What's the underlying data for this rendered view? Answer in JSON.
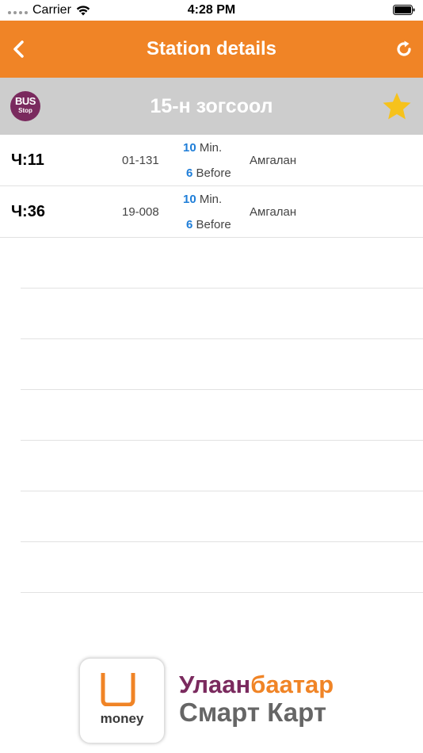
{
  "status_bar": {
    "carrier": "Carrier",
    "time": "4:28 PM"
  },
  "nav": {
    "title": "Station details",
    "back_icon": "chevron-left-icon",
    "refresh_icon": "refresh-icon"
  },
  "station": {
    "logo_line1": "BUS",
    "logo_line2": "Stop",
    "name": "15-н зогсоол",
    "favorite": true
  },
  "schedule": [
    {
      "time": "Ч:11",
      "number": "01-131",
      "mins_value": "10",
      "mins_label": " Min.",
      "before_value": "6",
      "before_label": " Before",
      "destination": "Амгалан"
    },
    {
      "time": "Ч:36",
      "number": "19-008",
      "mins_value": "10",
      "mins_label": " Min.",
      "before_value": "6",
      "before_label": " Before",
      "destination": "Амгалан"
    }
  ],
  "banner": {
    "logo_text": "money",
    "line1_part1": "Улаан",
    "line1_part2": "баатар",
    "line2": "Смарт Карт"
  },
  "colors": {
    "nav_orange": "#f08426",
    "header_gray": "#cdcdcd",
    "accent_blue": "#1f7ed8",
    "brand_purple": "#7a2a5e",
    "star_yellow": "#f6c21c"
  }
}
